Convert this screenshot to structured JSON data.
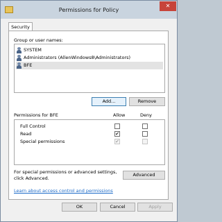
{
  "window": {
    "title": "Permissions for Policy",
    "close": "✕"
  },
  "tabs": [
    {
      "label": "Security"
    }
  ],
  "group_label": "Group or user names:",
  "users": [
    {
      "name": "SYSTEM",
      "selected": false
    },
    {
      "name": "Administrators (AllenWindows8\\Administrators)",
      "selected": false
    },
    {
      "name": "BFE",
      "selected": true
    }
  ],
  "buttons": {
    "add": "Add...",
    "remove": "Remove",
    "advanced": "Advanced",
    "ok": "OK",
    "cancel": "Cancel",
    "apply": "Apply"
  },
  "permissions": {
    "header": "Permissions for BFE",
    "allow_label": "Allow",
    "deny_label": "Deny",
    "rows": [
      {
        "name": "Full Control",
        "allow": false,
        "deny": false,
        "disabled": false
      },
      {
        "name": "Read",
        "allow": true,
        "deny": false,
        "disabled": false
      },
      {
        "name": "Special permissions",
        "allow": true,
        "deny": false,
        "disabled": true
      }
    ]
  },
  "special_note": "For special permissions or advanced settings, click Advanced.",
  "learn_link": "Learn about access control and permissions"
}
